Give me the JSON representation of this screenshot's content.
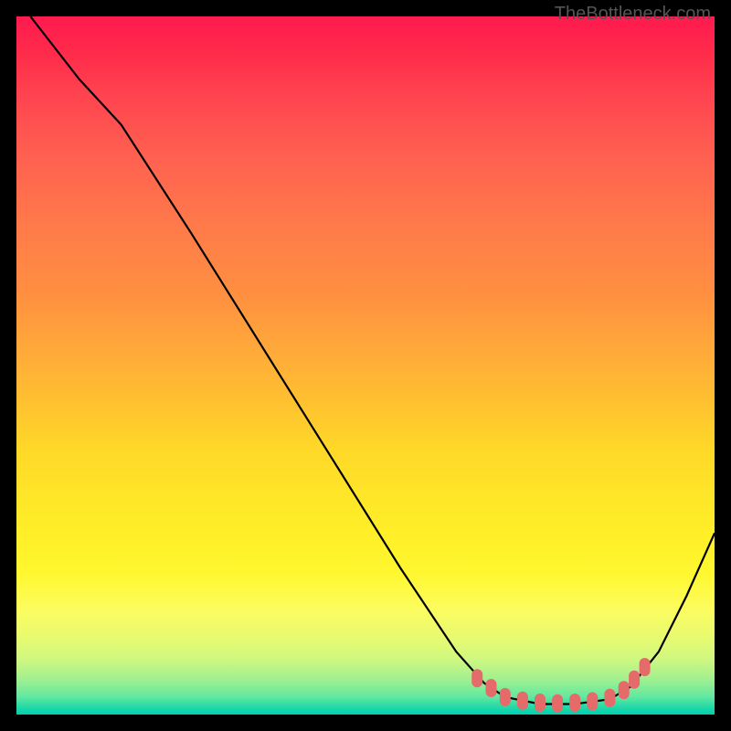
{
  "watermark": "TheBottleneck.com",
  "chart_data": {
    "type": "line",
    "title": "",
    "xlabel": "",
    "ylabel": "",
    "xlim": [
      0,
      100
    ],
    "ylim": [
      0,
      100
    ],
    "series": [
      {
        "name": "curve",
        "type": "line",
        "color": "#000000",
        "points": [
          {
            "x": 2,
            "y": 100
          },
          {
            "x": 9,
            "y": 91
          },
          {
            "x": 15,
            "y": 84.5
          },
          {
            "x": 25,
            "y": 69
          },
          {
            "x": 35,
            "y": 53
          },
          {
            "x": 45,
            "y": 37
          },
          {
            "x": 55,
            "y": 21
          },
          {
            "x": 63,
            "y": 9
          },
          {
            "x": 67,
            "y": 4.5
          },
          {
            "x": 70,
            "y": 2.5
          },
          {
            "x": 75,
            "y": 1.5
          },
          {
            "x": 80,
            "y": 1.5
          },
          {
            "x": 85,
            "y": 2.2
          },
          {
            "x": 88,
            "y": 4
          },
          {
            "x": 92,
            "y": 9
          },
          {
            "x": 96,
            "y": 17
          },
          {
            "x": 100,
            "y": 26
          }
        ]
      },
      {
        "name": "marker-band",
        "type": "scatter",
        "color": "#e56a6a",
        "shape": "rounded-rect",
        "points": [
          {
            "x": 66,
            "y": 5.2
          },
          {
            "x": 68,
            "y": 3.8
          },
          {
            "x": 70,
            "y": 2.5
          },
          {
            "x": 72.5,
            "y": 2.0
          },
          {
            "x": 75,
            "y": 1.7
          },
          {
            "x": 77.5,
            "y": 1.6
          },
          {
            "x": 80,
            "y": 1.7
          },
          {
            "x": 82.5,
            "y": 1.9
          },
          {
            "x": 85,
            "y": 2.4
          },
          {
            "x": 87,
            "y": 3.5
          },
          {
            "x": 88.5,
            "y": 5.0
          },
          {
            "x": 90,
            "y": 6.8
          }
        ]
      }
    ]
  }
}
